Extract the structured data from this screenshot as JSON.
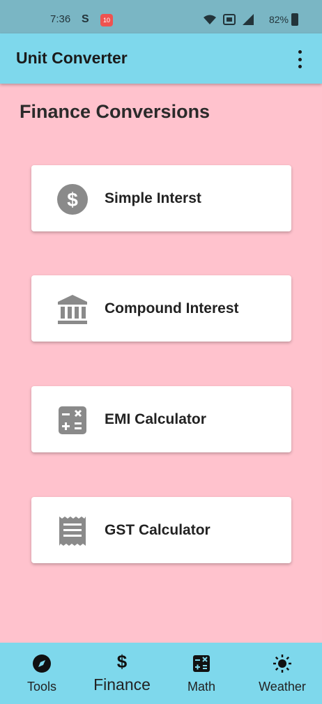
{
  "status_bar": {
    "time": "7:36",
    "s_indicator": "S",
    "notification_badge": "10",
    "battery": "82%"
  },
  "app_bar": {
    "title": "Unit Converter",
    "menu_icon": "more-vert-icon"
  },
  "page": {
    "title": "Finance Conversions"
  },
  "cards": [
    {
      "label": "Simple Interst",
      "icon": "dollar-circle-icon"
    },
    {
      "label": "Compound Interest",
      "icon": "bank-icon"
    },
    {
      "label": "EMI Calculator",
      "icon": "calculator-icon"
    },
    {
      "label": "GST Calculator",
      "icon": "receipt-icon"
    }
  ],
  "bottom_nav": {
    "items": [
      {
        "label": "Tools",
        "icon": "compass-icon"
      },
      {
        "label": "Finance",
        "icon": "dollar-icon"
      },
      {
        "label": "Math",
        "icon": "calculator-icon"
      },
      {
        "label": "Weather",
        "icon": "sun-icon"
      }
    ],
    "active": "Finance"
  },
  "colors": {
    "background": "#ffc2cd",
    "app_bar": "#7ed8ec",
    "status_bar": "#7ab6c4",
    "card": "#ffffff",
    "icon": "#8a8a8a"
  }
}
